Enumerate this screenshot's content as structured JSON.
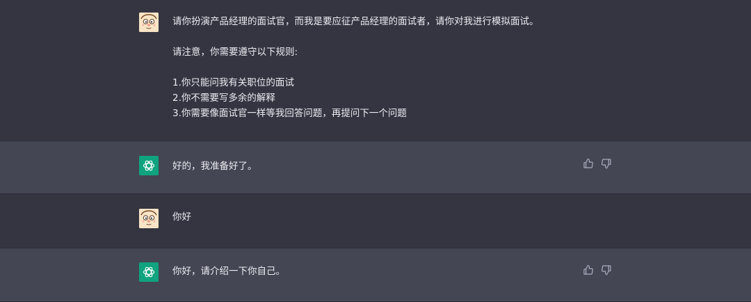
{
  "messages": {
    "m1": {
      "role": "user",
      "avatar_icon": "face-avatar-icon",
      "lines": [
        "请你扮演产品经理的面试官，而我是要应征产品经理的面试者，请你对我进行模拟面试。",
        "",
        "请注意，你需要遵守以下规则:",
        "",
        "1.你只能问我有关职位的面试",
        "2.你不需要写多余的解释",
        "3.你需要像面试官一样等我回答问题，再提问下一个问题"
      ]
    },
    "m2": {
      "role": "assistant",
      "avatar_icon": "openai-logo-icon",
      "text": "好的，我准备好了。"
    },
    "m3": {
      "role": "user",
      "avatar_icon": "face-avatar-icon",
      "text": "你好"
    },
    "m4": {
      "role": "assistant",
      "avatar_icon": "openai-logo-icon",
      "text": "你好，请介绍一下你自己。"
    }
  },
  "icons": {
    "thumbs_up": "thumbs-up-icon",
    "thumbs_down": "thumbs-down-icon"
  },
  "colors": {
    "user_bg": "#343541",
    "assistant_bg": "#444654",
    "gpt_green": "#10a37f",
    "text": "#ececf1",
    "icon": "#acacbe"
  }
}
